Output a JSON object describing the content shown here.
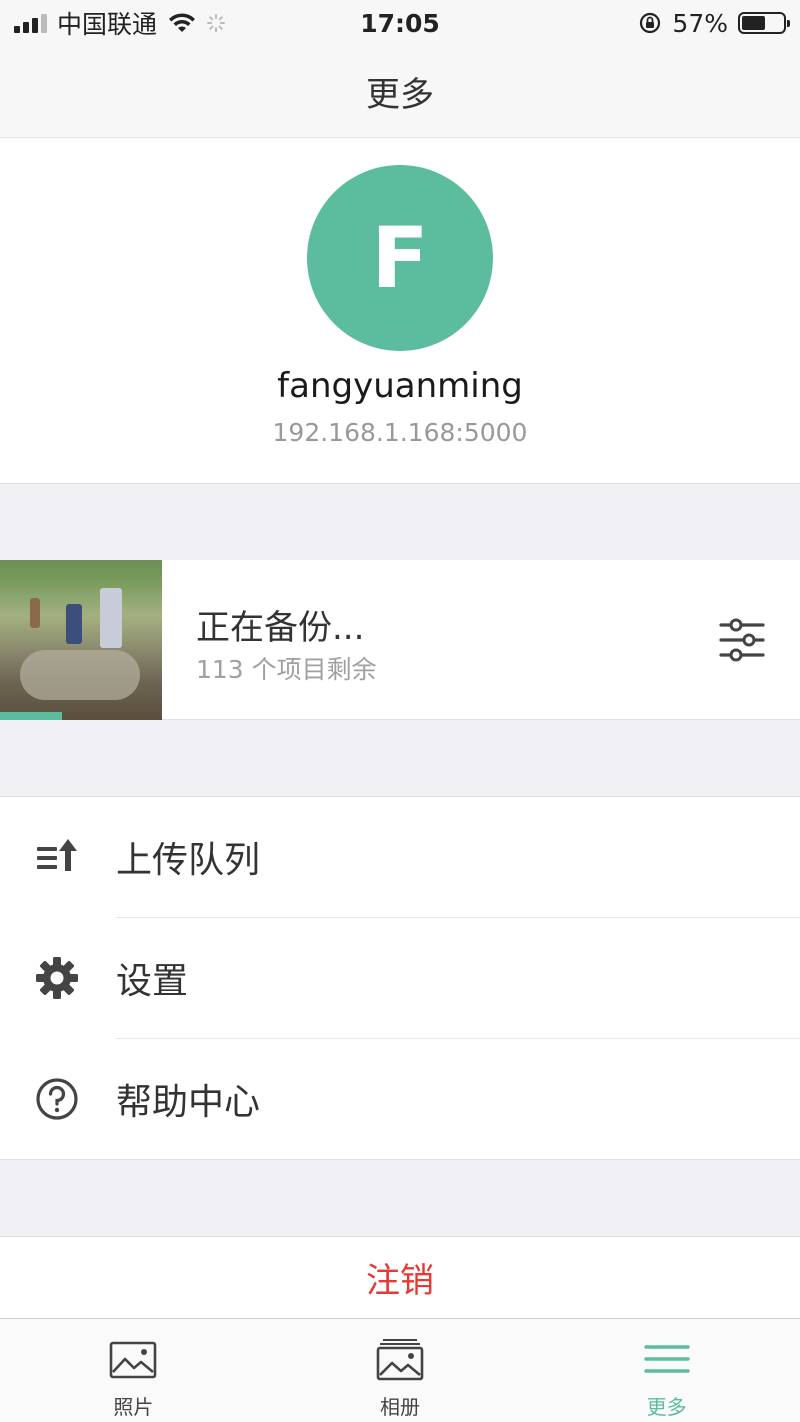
{
  "status_bar": {
    "carrier": "中国联通",
    "time": "17:05",
    "battery": "57%"
  },
  "nav": {
    "title": "更多"
  },
  "profile": {
    "avatar_letter": "F",
    "username": "fangyuanming",
    "server": "192.168.1.168:5000",
    "avatar_color": "#5bbc9e"
  },
  "backup": {
    "title": "正在备份...",
    "subtitle": "113 个项目剩余",
    "progress_fraction": 0.38
  },
  "menu": {
    "items": [
      {
        "label": "上传队列",
        "icon": "upload-queue-icon"
      },
      {
        "label": "设置",
        "icon": "gear-icon"
      },
      {
        "label": "帮助中心",
        "icon": "help-icon"
      }
    ]
  },
  "logout": {
    "label": "注销",
    "color": "#e53935"
  },
  "tabs": [
    {
      "label": "照片",
      "icon": "photo-icon"
    },
    {
      "label": "相册",
      "icon": "album-icon"
    },
    {
      "label": "更多",
      "icon": "menu-icon",
      "active": true
    }
  ],
  "accent_color": "#5bbc9e"
}
